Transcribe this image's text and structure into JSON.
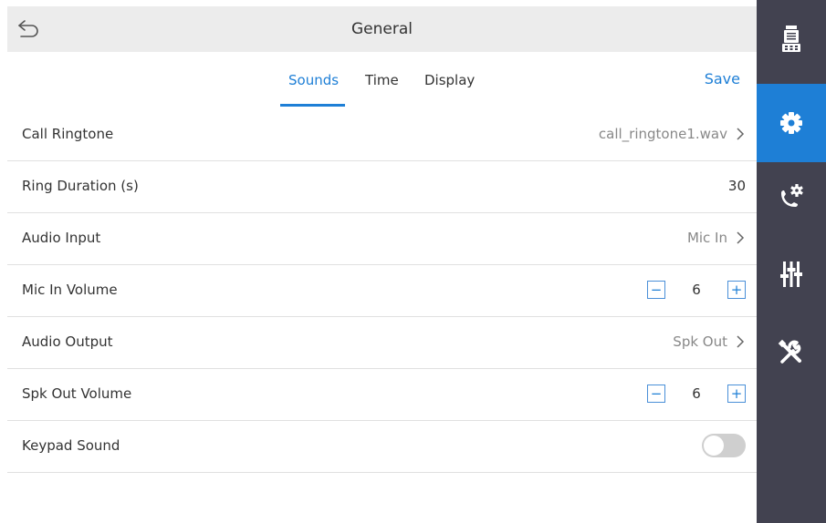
{
  "header": {
    "title": "General"
  },
  "tabs": [
    {
      "label": "Sounds",
      "active": true
    },
    {
      "label": "Time",
      "active": false
    },
    {
      "label": "Display",
      "active": false
    }
  ],
  "save_label": "Save",
  "settings": [
    {
      "label": "Call Ringtone",
      "value": "call_ringtone1.wav",
      "control": "chevron"
    },
    {
      "label": "Ring Duration (s)",
      "value": "30",
      "control": "text"
    },
    {
      "label": "Audio Input",
      "value": "Mic In",
      "control": "chevron"
    },
    {
      "label": "Mic In Volume",
      "value": "6",
      "control": "stepper"
    },
    {
      "label": "Audio Output",
      "value": "Spk Out",
      "control": "chevron"
    },
    {
      "label": "Spk Out Volume",
      "value": "6",
      "control": "stepper"
    },
    {
      "label": "Keypad Sound",
      "value": false,
      "control": "toggle"
    }
  ],
  "stepper": {
    "minus": "−",
    "plus": "+"
  },
  "sidebar": {
    "items": [
      {
        "icon": "intercom-device-icon",
        "active": false
      },
      {
        "icon": "gear-icon",
        "active": true
      },
      {
        "icon": "call-settings-icon",
        "active": false
      },
      {
        "icon": "sliders-icon",
        "active": false
      },
      {
        "icon": "tools-icon",
        "active": false
      }
    ]
  },
  "colors": {
    "accent": "#1e7fd6",
    "sidebar": "#424250",
    "titlebar": "#ececec",
    "toggle_off": "#cfcfcf"
  }
}
